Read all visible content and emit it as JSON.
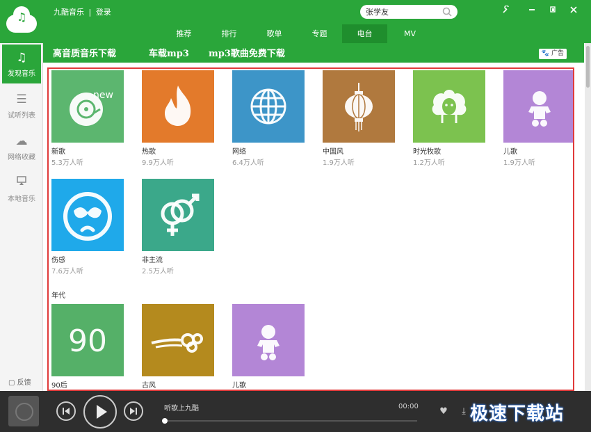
{
  "header": {
    "app_name": "九酷音乐",
    "separator": "|",
    "login_label": "登录",
    "search_value": "张学友",
    "window_controls": [
      "wrench-icon",
      "minimize-icon",
      "restore-icon",
      "close-icon"
    ]
  },
  "tabs": [
    {
      "label": "推荐",
      "active": false
    },
    {
      "label": "排行",
      "active": false
    },
    {
      "label": "歌单",
      "active": false
    },
    {
      "label": "专题",
      "active": false
    },
    {
      "label": "电台",
      "active": true
    },
    {
      "label": "MV",
      "active": false
    }
  ],
  "sidebar": {
    "items": [
      {
        "label": "发现音乐",
        "icon": "music-note-icon",
        "active": true
      },
      {
        "label": "试听列表",
        "icon": "list-icon",
        "active": false
      },
      {
        "label": "网络收藏",
        "icon": "cloud-icon",
        "active": false
      },
      {
        "label": "本地音乐",
        "icon": "monitor-icon",
        "active": false
      }
    ],
    "feedback_label": "反馈"
  },
  "banner": {
    "links": [
      "高音质音乐下载",
      "车载mp3",
      "mp3歌曲免费下载"
    ],
    "ad_label": "广告"
  },
  "stations_row1": [
    {
      "title": "新歌",
      "listeners": "5.3万人听",
      "color": "#5cb66f",
      "icon": "cd-new-icon"
    },
    {
      "title": "热歌",
      "listeners": "9.9万人听",
      "color": "#e37a2b",
      "icon": "flame-icon"
    },
    {
      "title": "网络",
      "listeners": "6.4万人听",
      "color": "#3d95c8",
      "icon": "globe-icon"
    },
    {
      "title": "中国风",
      "listeners": "1.9万人听",
      "color": "#b0793e",
      "icon": "lantern-icon"
    },
    {
      "title": "时光牧歌",
      "listeners": "1.2万人听",
      "color": "#7cc24f",
      "icon": "sheep-icon"
    },
    {
      "title": "儿歌",
      "listeners": "1.9万人听",
      "color": "#b386d6",
      "icon": "baby-icon"
    }
  ],
  "stations_row2": [
    {
      "title": "伤感",
      "listeners": "7.6万人听",
      "color": "#1fa9ea",
      "icon": "sad-face-icon"
    },
    {
      "title": "非主流",
      "listeners": "2.5万人听",
      "color": "#3ba88a",
      "icon": "gender-icon"
    }
  ],
  "section_era": "年代",
  "stations_row3": [
    {
      "title": "90后",
      "color": "#55b068",
      "icon": "ninety-icon",
      "caption": "90"
    },
    {
      "title": "古风",
      "color": "#b48a1e",
      "icon": "cloud-swirl-icon"
    },
    {
      "title": "儿歌",
      "color": "#b386d6",
      "icon": "baby-icon"
    }
  ],
  "player": {
    "song_title": "听歌上九酷",
    "time": "00:00",
    "progress": 0
  },
  "watermark": "极速下载站"
}
